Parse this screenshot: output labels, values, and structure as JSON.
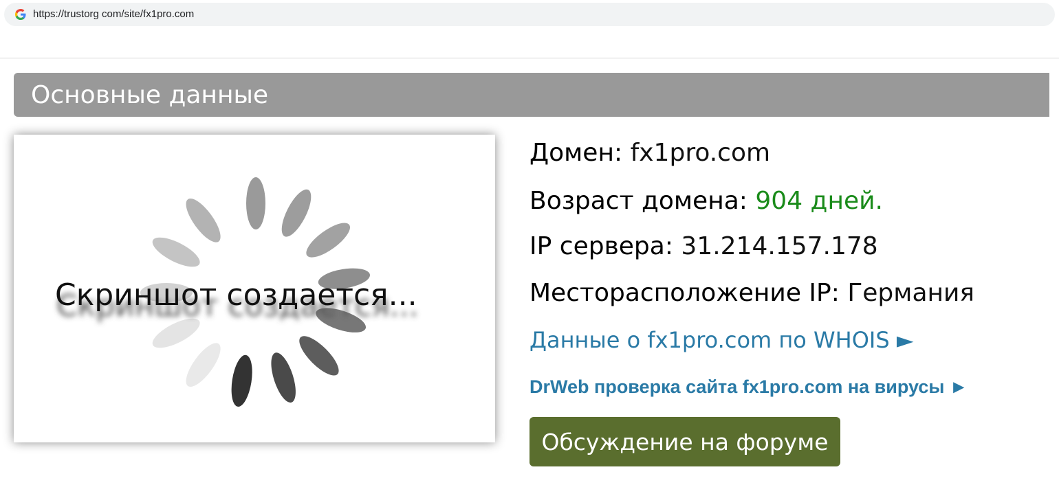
{
  "browser": {
    "url": "https://trustorg com/site/fx1pro.com"
  },
  "section": {
    "title": "Основные данные"
  },
  "screenshot": {
    "placeholder_text": "Скриншот создается..."
  },
  "info": {
    "domain_label": "Домен:",
    "domain_value": "fx1pro.com",
    "age_label": "Возраст домена:",
    "age_value": "904 дней.",
    "ip_label": "IP сервера:",
    "ip_value": "31.214.157.178",
    "location_label": "Месторасположение IP:",
    "location_value": "Германия"
  },
  "links": {
    "whois": "Данные о fx1pro.com по WHOIS ►",
    "drweb": "DrWeb проверка сайта fx1pro.com на вирусы ►"
  },
  "forum_button": "Обсуждение на форуме",
  "colors": {
    "header_bg": "#999999",
    "age_green": "#1a8b1a",
    "link_blue": "#2a7aa6",
    "button_green": "#5a6e2e"
  }
}
